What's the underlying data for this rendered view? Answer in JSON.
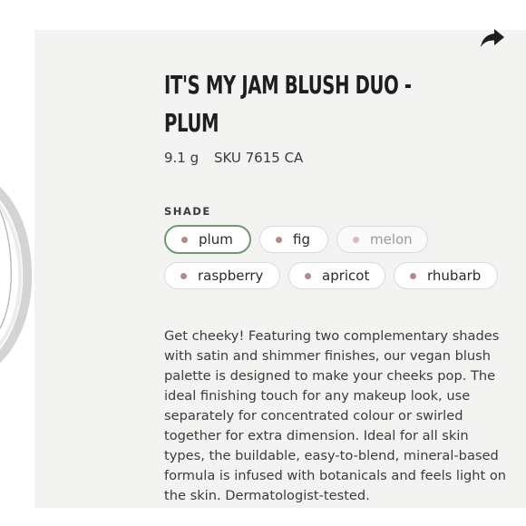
{
  "product": {
    "title_line1": "IT'S MY JAM BLUSH DUO -",
    "title_line2": "PLUM",
    "weight": "9.1 g",
    "sku": "SKU 7615 CA"
  },
  "shade": {
    "label": "SHADE",
    "options": [
      {
        "label": "plum",
        "state": "selected"
      },
      {
        "label": "fig",
        "state": "available"
      },
      {
        "label": "melon",
        "state": "unavailable"
      },
      {
        "label": "raspberry",
        "state": "available"
      },
      {
        "label": "apricot",
        "state": "available"
      },
      {
        "label": "rhubarb",
        "state": "available"
      }
    ]
  },
  "description": "Get cheeky! Featuring two complementary shades with satin and shimmer finishes, our vegan blush palette is designed to make your cheeks pop. The ideal finishing touch for any makeup look, use separately for concentrated colour or swirled together for extra dimension. Ideal for all skin types, the buildable, easy-to-blend, mineral-based formula is infused with botanicals and feels light on the skin. Dermatologist-tested.",
  "icons": {
    "share": "share-arrow-icon",
    "swatch": "swatch-dot-icon"
  },
  "colors": {
    "panel_bg": "#f3f3f1",
    "selected_border": "#6a9a72",
    "swatch": "#b88a8a"
  }
}
